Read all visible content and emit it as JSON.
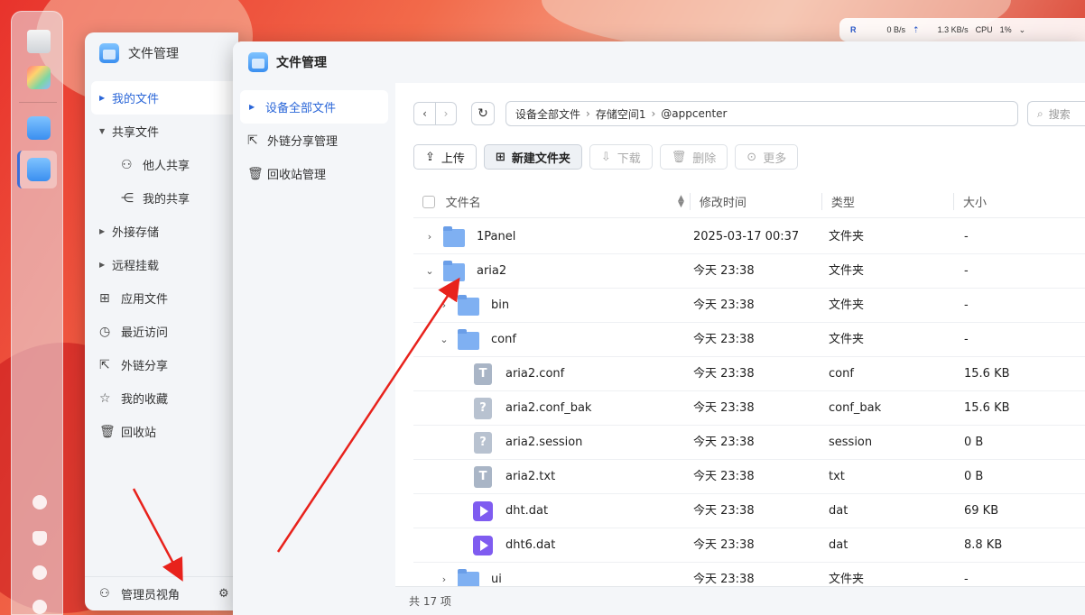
{
  "network": {
    "up_label": "R",
    "down_speed": "0  B/s",
    "up_speed": "1.3 KB/s",
    "cpu_label": "CPU",
    "cpu_value": "1%"
  },
  "back_window": {
    "title": "文件管理",
    "nav": [
      {
        "label": "我的文件"
      },
      {
        "label": "共享文件"
      },
      {
        "label": "他人共享"
      },
      {
        "label": "我的共享"
      },
      {
        "label": "外接存储"
      },
      {
        "label": "远程挂载"
      },
      {
        "label": "应用文件"
      },
      {
        "label": "最近访问"
      },
      {
        "label": "外链分享"
      },
      {
        "label": "我的收藏"
      },
      {
        "label": "回收站"
      }
    ],
    "footer_label": "管理员视角"
  },
  "window": {
    "title": "文件管理",
    "sidebar": [
      {
        "label": "设备全部文件"
      },
      {
        "label": "外链分享管理"
      },
      {
        "label": "回收站管理"
      }
    ],
    "breadcrumb": [
      "设备全部文件",
      "存储空间1",
      "@appcenter"
    ],
    "search_placeholder": "搜索",
    "toolbar": {
      "upload": "上传",
      "new_folder": "新建文件夹",
      "download": "下载",
      "delete": "删除",
      "more": "更多"
    },
    "columns": {
      "name": "文件名",
      "time": "修改时间",
      "type": "类型",
      "size": "大小"
    },
    "rows": [
      {
        "name": "1Panel",
        "time": "2025-03-17 00:37",
        "type": "文件夹",
        "size": "-"
      },
      {
        "name": "aria2",
        "time": "今天 23:38",
        "type": "文件夹",
        "size": "-"
      },
      {
        "name": "bin",
        "time": "今天 23:38",
        "type": "文件夹",
        "size": "-"
      },
      {
        "name": "conf",
        "time": "今天 23:38",
        "type": "文件夹",
        "size": "-"
      },
      {
        "name": "aria2.conf",
        "time": "今天 23:38",
        "type": "conf",
        "size": "15.6 KB",
        "glyph": "T"
      },
      {
        "name": "aria2.conf_bak",
        "time": "今天 23:38",
        "type": "conf_bak",
        "size": "15.6 KB",
        "glyph": "?"
      },
      {
        "name": "aria2.session",
        "time": "今天 23:38",
        "type": "session",
        "size": "0 B",
        "glyph": "?"
      },
      {
        "name": "aria2.txt",
        "time": "今天 23:38",
        "type": "txt",
        "size": "0 B",
        "glyph": "T"
      },
      {
        "name": "dht.dat",
        "time": "今天 23:38",
        "type": "dat",
        "size": "69 KB"
      },
      {
        "name": "dht6.dat",
        "time": "今天 23:38",
        "type": "dat",
        "size": "8.8 KB"
      },
      {
        "name": "ui",
        "time": "今天 23:38",
        "type": "文件夹",
        "size": "-"
      }
    ],
    "footer": "共 17 项"
  },
  "colors": {
    "accent": "#2a66d8",
    "annotation_arrow": "#e8221c",
    "folder": "#7fb0f2",
    "media": "#7f5cf0"
  }
}
